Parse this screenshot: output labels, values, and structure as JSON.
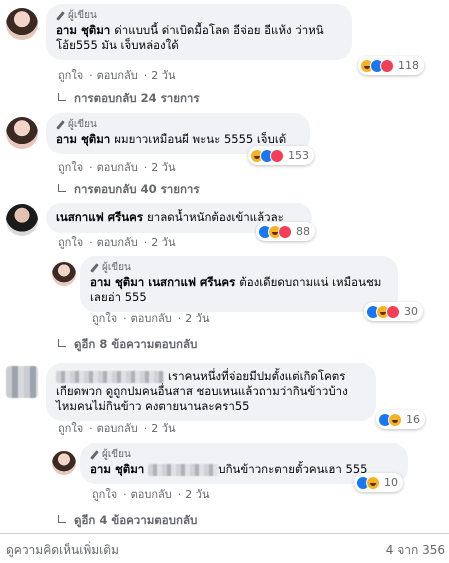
{
  "author_badge": "ผู้เขียน",
  "like_label": "ถูกใจ",
  "reply_label": "ตอบกลับ",
  "comments": [
    {
      "name": "อาม ชุติมา",
      "text": "ด่าแบบนี้ ด่าเบิดมื้อโลด อีจ่อย อีแห้ง ว่าหนิ โอ้ย555 มัน เจ็บหล่องใด้",
      "time": "2 วัน",
      "reactions": "118",
      "replies_link": "การตอบกลับ 24 รายการ"
    },
    {
      "name": "อาม ชุติมา",
      "text": "ผมยาวเหมือนผี พะนะ 5555 เจ็บเด้",
      "time": "2 วัน",
      "reactions": "153",
      "replies_link": "การตอบกลับ 40 รายการ"
    },
    {
      "name": "เนสกาแฟ ศรีนคร",
      "text": "ยาลดน้ำหนักต้องเข้าแล้วละ",
      "time": "2 วัน",
      "reactions": "88"
    },
    {
      "name": "อาม ชุติมา",
      "tag": "เนสกาแฟ ศรีนคร",
      "text": "ต้องเดียดบถามแน่ เหมือนชม เลยอ่า 555",
      "time": "2 วัน",
      "reactions": "30",
      "replies_link": "ดูอีก 8 ข้อความตอบกลับ"
    },
    {
      "text": "เราคนหนึ่งที่จ่อยมีปมตั้งแต่เกิดโคตรเกียดพวก ดูถูกปมคนอื่นสาส ชอบเหนแล้วถามว่ากินข้าวบ้างไหมคนไม่กินข้าว คงตายนานละครา55",
      "time": "2 วัน",
      "reactions": "16"
    },
    {
      "name": "อาม ชุติมา",
      "text": "บกินข้าวกะตายตั้วคนเฮา 555",
      "time": "2 วัน",
      "reactions": "10",
      "replies_link": "ดูอีก 4 ข้อความตอบกลับ"
    }
  ],
  "footer": {
    "more": "ดูความคิดเห็นเพิ่มเติม",
    "count": "4 จาก 356"
  }
}
